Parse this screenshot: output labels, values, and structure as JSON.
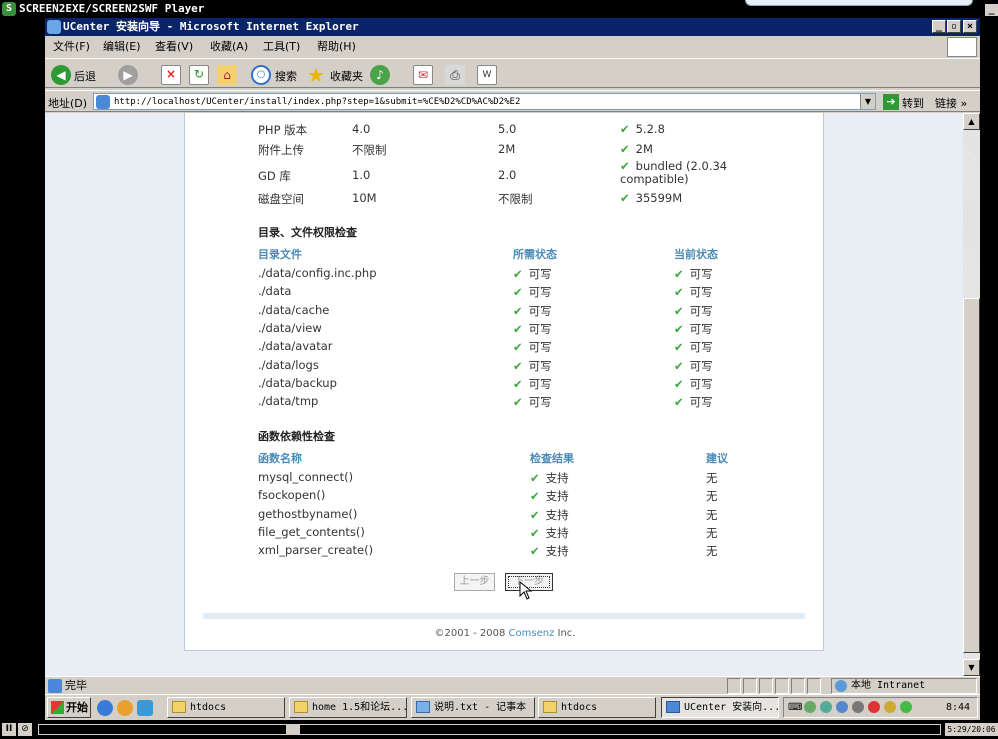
{
  "player": {
    "title": "SCREEN2EXE/SCREEN2SWF Player",
    "logo": "S",
    "time": "5:29/20:06"
  },
  "browser": {
    "title": "UCenter 安装向导 - Microsoft Internet Explorer",
    "menu": [
      "文件(F)",
      "编辑(E)",
      "查看(V)",
      "收藏(A)",
      "工具(T)",
      "帮助(H)"
    ],
    "toolbar": {
      "back": "后退",
      "search": "搜索",
      "favorites": "收藏夹"
    },
    "address": {
      "label": "地址(D)",
      "url": "http://localhost/UCenter/install/index.php?step=1&submit=%CE%D2%CD%AC%D2%E2",
      "go": "转到",
      "links": "链接 »"
    },
    "status": {
      "text": "完毕",
      "zone": "本地 Intranet"
    }
  },
  "env_table": {
    "rows": [
      {
        "item": "PHP 版本",
        "required": "4.0",
        "best": "5.0",
        "current": "5.2.8"
      },
      {
        "item": "附件上传",
        "required": "不限制",
        "best": "2M",
        "current": "2M"
      },
      {
        "item": "GD 库",
        "required": "1.0",
        "best": "2.0",
        "current": "bundled (2.0.34 compatible)"
      },
      {
        "item": "磁盘空间",
        "required": "10M",
        "best": "不限制",
        "current": "35599M"
      }
    ]
  },
  "dir_check": {
    "title": "目录、文件权限检查",
    "headers": [
      "目录文件",
      "所需状态",
      "当前状态"
    ],
    "rows": [
      {
        "path": "./data/config.inc.php",
        "required": "可写",
        "current": "可写"
      },
      {
        "path": "./data",
        "required": "可写",
        "current": "可写"
      },
      {
        "path": "./data/cache",
        "required": "可写",
        "current": "可写"
      },
      {
        "path": "./data/view",
        "required": "可写",
        "current": "可写"
      },
      {
        "path": "./data/avatar",
        "required": "可写",
        "current": "可写"
      },
      {
        "path": "./data/logs",
        "required": "可写",
        "current": "可写"
      },
      {
        "path": "./data/backup",
        "required": "可写",
        "current": "可写"
      },
      {
        "path": "./data/tmp",
        "required": "可写",
        "current": "可写"
      }
    ]
  },
  "func_check": {
    "title": "函数依赖性检查",
    "headers": [
      "函数名称",
      "检查结果",
      "建议"
    ],
    "rows": [
      {
        "name": "mysql_connect()",
        "result": "支持",
        "advice": "无"
      },
      {
        "name": "fsockopen()",
        "result": "支持",
        "advice": "无"
      },
      {
        "name": "gethostbyname()",
        "result": "支持",
        "advice": "无"
      },
      {
        "name": "file_get_contents()",
        "result": "支持",
        "advice": "无"
      },
      {
        "name": "xml_parser_create()",
        "result": "支持",
        "advice": "无"
      }
    ]
  },
  "buttons": {
    "prev": "上一步",
    "next": "下一步"
  },
  "footer": {
    "copyright": "©2001 - 2008 ",
    "brand": "Comsenz",
    "suffix": " Inc."
  },
  "taskbar": {
    "start": "开始",
    "tasks": [
      {
        "label": "htdocs",
        "active": false
      },
      {
        "label": "home 1.5和论坛...",
        "active": false
      },
      {
        "label": "说明.txt - 记事本",
        "active": false
      },
      {
        "label": "htdocs",
        "active": false
      },
      {
        "label": "UCenter 安装向...",
        "active": true
      }
    ],
    "clock": "8:44"
  },
  "colors": {
    "accent": "#4a8cb8",
    "check": "#3aa83a",
    "title_bar": "#0a246a"
  }
}
